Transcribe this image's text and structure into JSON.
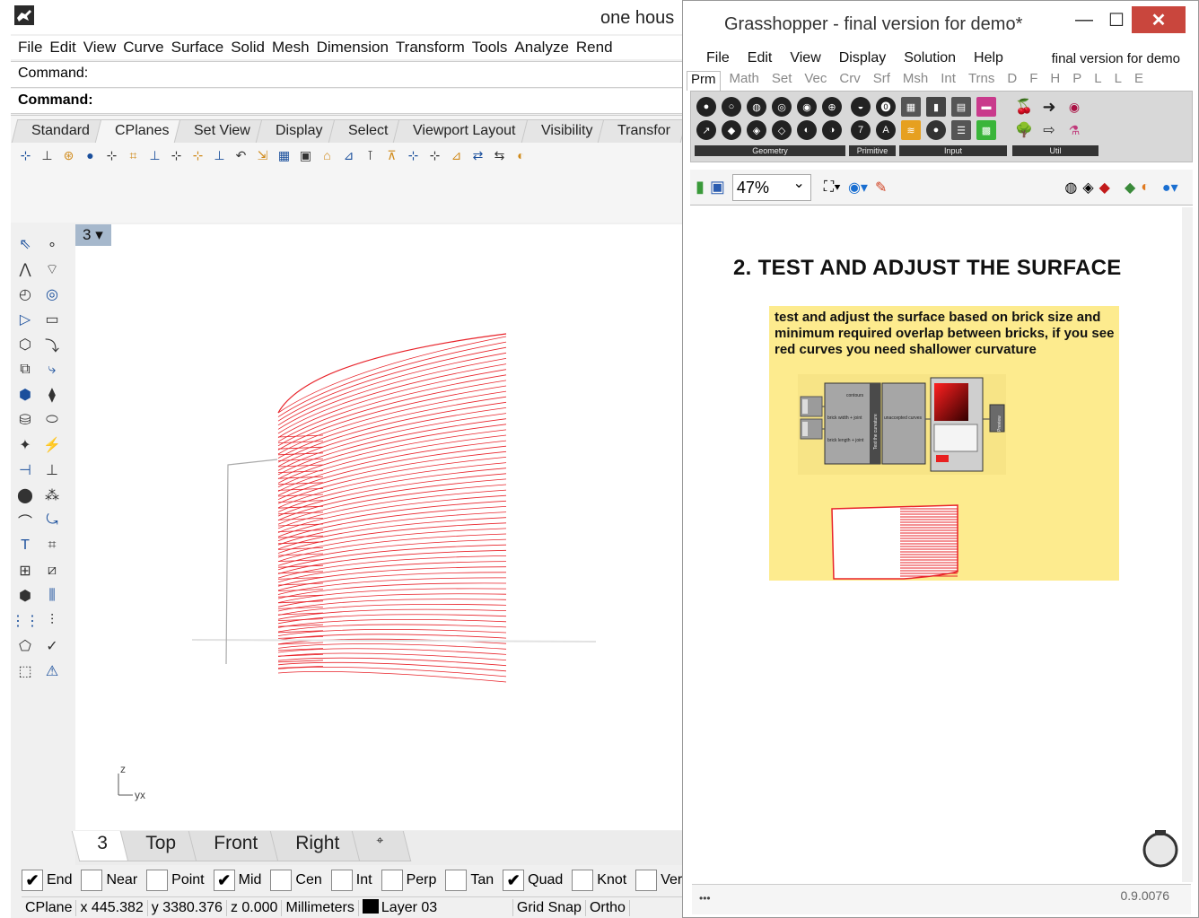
{
  "rhino": {
    "title": "one hous",
    "menu": [
      "File",
      "Edit",
      "View",
      "Curve",
      "Surface",
      "Solid",
      "Mesh",
      "Dimension",
      "Transform",
      "Tools",
      "Analyze",
      "Rend"
    ],
    "command_history": "Command:",
    "command_prompt": "Command:",
    "toolbar_tabs": [
      "Standard",
      "CPlanes",
      "Set View",
      "Display",
      "Select",
      "Viewport Layout",
      "Visibility",
      "Transfor"
    ],
    "active_toolbar_tab": "CPlanes",
    "viewport_label": "3",
    "axis_z": "z",
    "axis_yx": "yx",
    "viewport_tabs": [
      "3",
      "Top",
      "Front",
      "Right"
    ],
    "viewport_tab_add": "⌖",
    "osnaps": [
      {
        "label": "End",
        "checked": true
      },
      {
        "label": "Near",
        "checked": false
      },
      {
        "label": "Point",
        "checked": false
      },
      {
        "label": "Mid",
        "checked": true
      },
      {
        "label": "Cen",
        "checked": false
      },
      {
        "label": "Int",
        "checked": false
      },
      {
        "label": "Perp",
        "checked": false
      },
      {
        "label": "Tan",
        "checked": false
      },
      {
        "label": "Quad",
        "checked": true
      },
      {
        "label": "Knot",
        "checked": false
      },
      {
        "label": "Vertex",
        "checked": false
      }
    ],
    "status": {
      "cplane": "CPlane",
      "x": "x 445.382",
      "y": "y 3380.376",
      "z": "z 0.000",
      "units": "Millimeters",
      "layer": "Layer 03",
      "grid_snap": "Grid Snap",
      "ortho": "Ortho"
    },
    "curve_color": "#e8232a"
  },
  "grasshopper": {
    "title": "Grasshopper - final version for demo*",
    "window_buttons": {
      "minimize": "—",
      "maximize": "☐",
      "close": "✕"
    },
    "menu": [
      "File",
      "Edit",
      "View",
      "Display",
      "Solution",
      "Help"
    ],
    "document_name": "final version for demo",
    "category_tabs": [
      "Prm",
      "Math",
      "Set",
      "Vec",
      "Crv",
      "Srf",
      "Msh",
      "Int",
      "Trns",
      "D",
      "F",
      "H",
      "P",
      "L",
      "L",
      "E"
    ],
    "active_category": "Prm",
    "ribbon_groups": [
      "Geometry",
      "Primitive",
      "Input",
      "Util"
    ],
    "zoom": "47%",
    "heading": "2. TEST AND ADJUST THE SURFACE",
    "group_note": "test and adjust the surface based on brick size and minimum required overlap between bricks, if you see red curves you need shallower curvature",
    "component": {
      "name": "Test the curvature",
      "inputs": [
        "contours",
        "brick width + joint",
        "brick length + joint"
      ],
      "output": "unaccepted curves",
      "preview_label": "Preview"
    },
    "group_color": "#fdeb8e",
    "version": "0.9.0076"
  }
}
